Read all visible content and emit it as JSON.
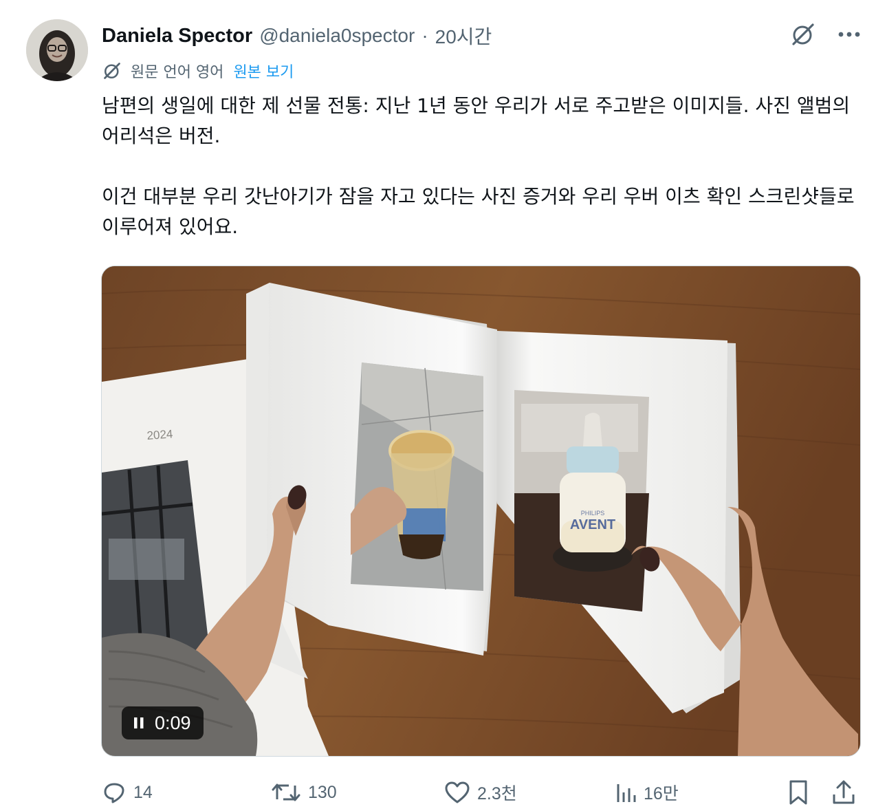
{
  "author": {
    "name": "Daniela Spector",
    "handle": "@daniela0spector",
    "time": "20시간"
  },
  "translation": {
    "label": "원문 언어 영어",
    "link": "원본 보기"
  },
  "text": {
    "p1": "남편의 생일에 대한 제 선물 전통: 지난 1년 동안 우리가 서로 주고받은 이미지들. 사진 앨범의 어리석은 버전.",
    "p2": "이건 대부분 우리 갓난아기가 잠을 자고 있다는 사진 증거와 우리 우버 이츠 확인 스크린샷들로 이루어져 있어요."
  },
  "media": {
    "timestamp": "0:09",
    "album_year": "2024",
    "bottle_brand": "PHILIPS",
    "bottle_logo": "AVENT"
  },
  "actions": {
    "replies": "14",
    "reposts": "130",
    "likes": "2.3천",
    "views": "16만"
  },
  "colors": {
    "link": "#1d9bf0",
    "muted": "#536471",
    "text": "#0f1419"
  },
  "icons": [
    "grok-icon",
    "more-icon",
    "translate-icon",
    "pause-icon",
    "reply-icon",
    "repost-icon",
    "like-icon",
    "views-icon",
    "bookmark-icon",
    "share-icon"
  ]
}
